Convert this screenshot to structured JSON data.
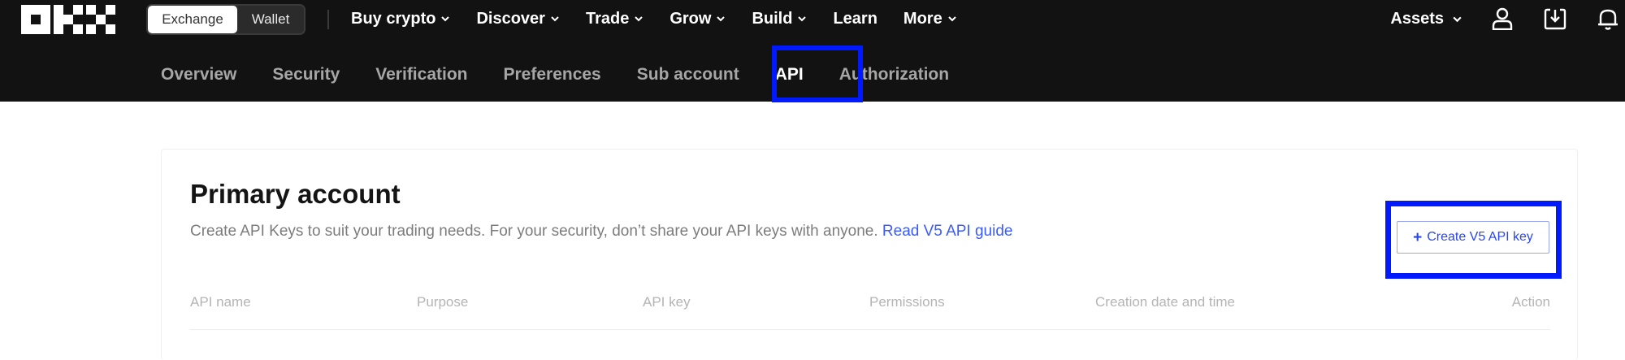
{
  "header": {
    "logo_text": "OKX",
    "mode_switch": {
      "options": [
        "Exchange",
        "Wallet"
      ],
      "selected": "Exchange"
    },
    "nav": [
      {
        "label": "Buy crypto",
        "has_dropdown": true
      },
      {
        "label": "Discover",
        "has_dropdown": true
      },
      {
        "label": "Trade",
        "has_dropdown": true
      },
      {
        "label": "Grow",
        "has_dropdown": true
      },
      {
        "label": "Build",
        "has_dropdown": true
      },
      {
        "label": "Learn",
        "has_dropdown": false
      },
      {
        "label": "More",
        "has_dropdown": true
      }
    ],
    "assets_label": "Assets",
    "icons": [
      "user-icon",
      "download-icon",
      "bell-icon"
    ]
  },
  "subnav": {
    "tabs": [
      "Overview",
      "Security",
      "Verification",
      "Preferences",
      "Sub account",
      "API",
      "Authorization"
    ],
    "active": "API"
  },
  "card": {
    "title": "Primary account",
    "description": "Create API Keys to suit your trading needs. For your security, don’t share your API keys with anyone.",
    "guide_link": "Read V5 API guide",
    "create_button": "Create V5 API key",
    "table_headers": [
      "API name",
      "Purpose",
      "API key",
      "Permissions",
      "Creation date and time",
      "Action"
    ]
  },
  "colors": {
    "topbar_bg": "#121212",
    "highlight": "#0019ff",
    "link": "#3b5bfb"
  }
}
